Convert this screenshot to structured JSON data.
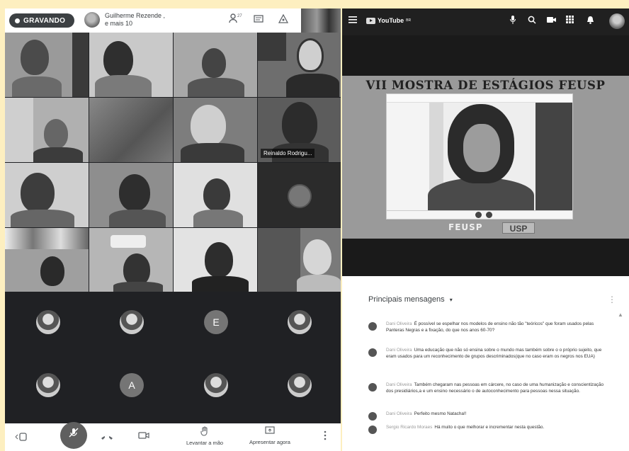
{
  "meet": {
    "recording_label": "GRAVANDO",
    "host_line1": "Guilherme Rezende ,",
    "host_line2": "e mais 10",
    "participants_badge": "27",
    "tile_label": "Reinaldo Rodrigu...",
    "avatar_letters": [
      "E",
      "A"
    ],
    "controls": {
      "raise_hand": "Levantar a mão",
      "present_now": "Apresentar agora"
    }
  },
  "youtube": {
    "logo_text": "YouTube",
    "logo_sup": "BR",
    "slide_title": "VII MOSTRA DE ESTÁGIOS FEUSP",
    "slide_logo_left": "FEUSP",
    "slide_logo_right": "USP",
    "chat": {
      "header": "Principais mensagens",
      "messages": [
        {
          "author": "Dani Oliveira",
          "text": "É possível se espelhar nos modelos de ensino não tão \"teóricos\" que foram usados pelas Panteras Negras e a fixação, do que nos anos 60-70?"
        },
        {
          "author": "Dani Oliveira",
          "text": "Uma educação que não só ensina sobre o mundo mas também sobre o o próprio sujeito, que eram usados para um reconhecimento de grupos descriminados(que no caso eram os negros nos EUA)"
        },
        {
          "author": "Dani Oliveira",
          "text": "Também chegaram nas pessoas em cárcere, no caso de uma humanização e conscientização dos presidiários,a e um ensino necessário o de autoconhecimento para pessoas nessa situação."
        },
        {
          "author": "Dani Oliveira",
          "text": "Perfeito mesmo Natacha!!"
        },
        {
          "author": "Sergio Ricardo Moraes",
          "text": "Há muito o que melhorar e incrementar nesta questão."
        }
      ]
    }
  }
}
